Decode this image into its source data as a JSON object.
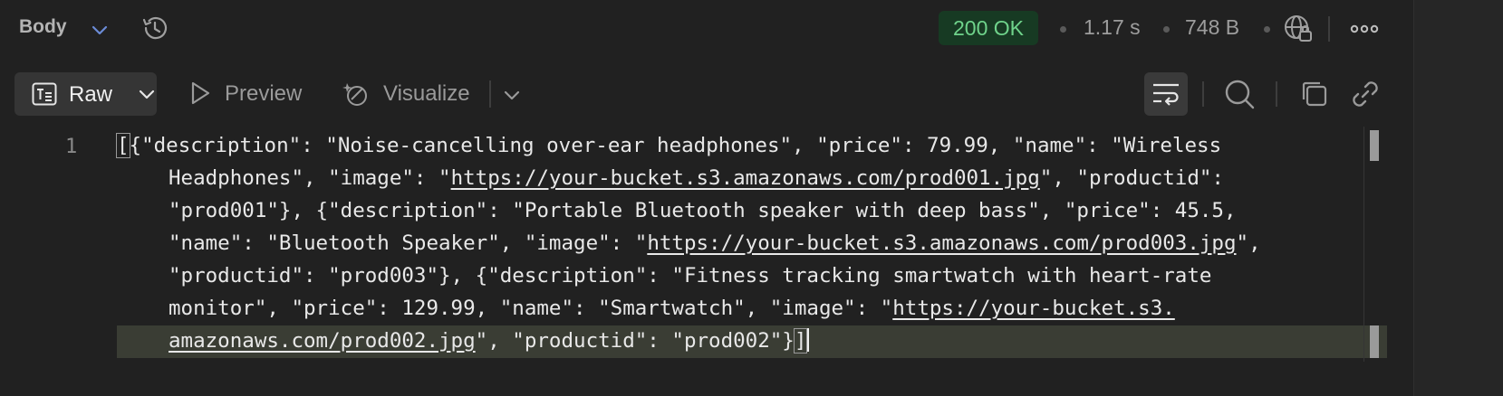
{
  "topbar": {
    "body_label": "Body",
    "status": "200 OK",
    "time": "1.17 s",
    "size": "748 B"
  },
  "toolbar": {
    "raw_label": "Raw",
    "preview_label": "Preview",
    "visualize_label": "Visualize"
  },
  "editor": {
    "line_number": "1",
    "lines": [
      {
        "pre": "{\"description\": \"Noise-cancelling over-ear headphones\", \"price\": 79.99, \"name\": \"Wireless"
      },
      {
        "pre": "Headphones\", \"image\": \"",
        "link": "https://your-bucket.s3.amazonaws.com/prod001.jpg",
        "post": "\", \"productid\":"
      },
      {
        "pre": "\"prod001\"}, {\"description\": \"Portable Bluetooth speaker with deep bass\", \"price\": 45.5,"
      },
      {
        "pre": "\"name\": \"Bluetooth Speaker\", \"image\": \"",
        "link": "https://your-bucket.s3.amazonaws.com/prod003.jpg",
        "post": "\","
      },
      {
        "pre": "\"productid\": \"prod003\"}, {\"description\": \"Fitness tracking smartwatch with heart-rate"
      },
      {
        "pre": "monitor\", \"price\": 129.99, \"name\": \"Smartwatch\", \"image\": \"",
        "link": "https://your-bucket.s3."
      },
      {
        "link": "amazonaws.com/prod002.jpg",
        "post": "\", \"productid\": \"prod002\"}"
      }
    ],
    "open_bracket": "[",
    "close_bracket": "]"
  },
  "colors": {
    "status_bg": "#173a23",
    "status_text": "#6fd38b",
    "accent": "#6b8bd6"
  }
}
